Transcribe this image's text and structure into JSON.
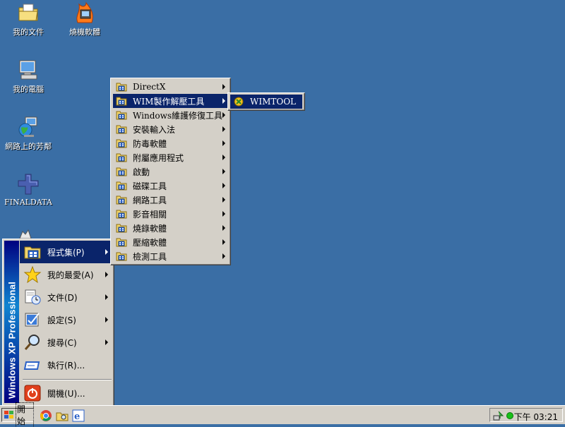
{
  "desktop": {
    "icons": [
      {
        "label": "我的文件"
      },
      {
        "label": "燒機軟體"
      },
      {
        "label": "我的電腦"
      },
      {
        "label": "網路上的芳鄰"
      },
      {
        "label": "FINALDATA"
      }
    ]
  },
  "start_menu": {
    "banner": "Windows XP Professional",
    "items": [
      {
        "label": "程式集(P)",
        "icon": "programs-folder-icon",
        "submenu": true,
        "active": true
      },
      {
        "label": "我的最愛(A)",
        "icon": "star-icon",
        "submenu": true
      },
      {
        "label": "文件(D)",
        "icon": "documents-icon",
        "submenu": true
      },
      {
        "label": "設定(S)",
        "icon": "settings-icon",
        "submenu": true
      },
      {
        "label": "搜尋(C)",
        "icon": "magnifier-icon",
        "submenu": true
      },
      {
        "label": "執行(R)...",
        "icon": "run-icon",
        "submenu": false
      },
      {
        "label": "關機(U)...",
        "icon": "shutdown-icon",
        "submenu": false
      }
    ]
  },
  "programs_menu": {
    "items": [
      {
        "label": "DirectX"
      },
      {
        "label": "WIM製作解壓工具",
        "active": true
      },
      {
        "label": "Windows維護修復工具"
      },
      {
        "label": "安裝輸入法"
      },
      {
        "label": "防毒軟體"
      },
      {
        "label": "附屬應用程式"
      },
      {
        "label": "啟動"
      },
      {
        "label": "磁碟工具"
      },
      {
        "label": "網路工具"
      },
      {
        "label": "影音相關"
      },
      {
        "label": "燒錄軟體"
      },
      {
        "label": "壓縮軟體"
      },
      {
        "label": "檢測工具"
      }
    ]
  },
  "wim_menu": {
    "items": [
      {
        "label": "WIMTOOL"
      }
    ]
  },
  "taskbar": {
    "start_label": "開始",
    "clock": "下午 03:21"
  },
  "colors": {
    "desktop": "#3a6ea5",
    "highlight": "#0a246a",
    "face": "#d4d0c8"
  }
}
